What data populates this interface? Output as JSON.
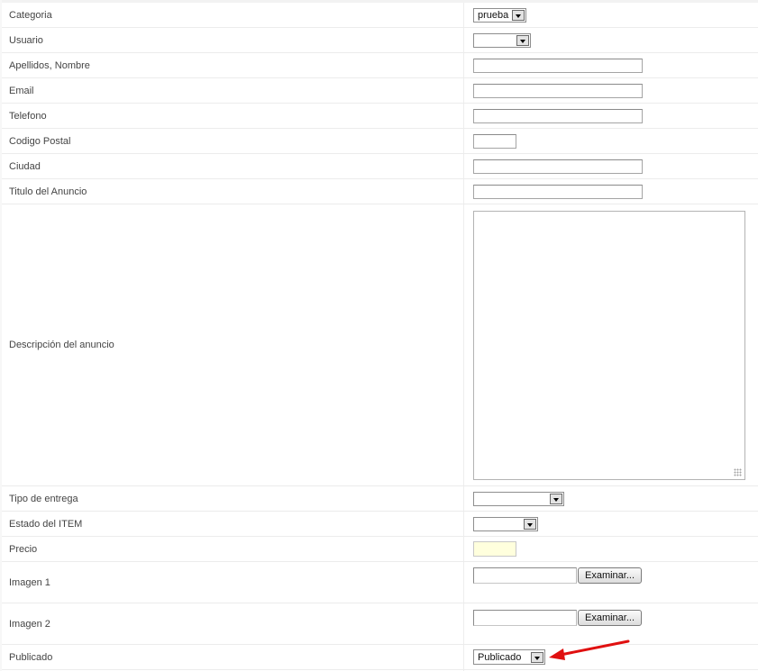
{
  "form": {
    "rows": [
      {
        "label": "Categoria"
      },
      {
        "label": "Usuario"
      },
      {
        "label": "Apellidos, Nombre"
      },
      {
        "label": "Email"
      },
      {
        "label": "Telefono"
      },
      {
        "label": "Codigo Postal"
      },
      {
        "label": "Ciudad"
      },
      {
        "label": "Titulo del Anuncio"
      },
      {
        "label": "Descripción del anuncio"
      },
      {
        "label": "Tipo de entrega"
      },
      {
        "label": "Estado del ITEM"
      },
      {
        "label": "Precio"
      },
      {
        "label": "Imagen 1"
      },
      {
        "label": "Imagen 2"
      },
      {
        "label": "Publicado"
      }
    ],
    "categoria_value": "prueba",
    "usuario_value": "",
    "tipo_entrega_value": "",
    "estado_item_value": "",
    "imagen_button_label": "Examinar...",
    "publicado_value": "Publicado"
  },
  "colors": {
    "annotation_arrow": "#e01010",
    "precio_highlight": "#ffffdd"
  },
  "icons": {
    "dropdown": "chevron-down-icon",
    "resize": "resize-grip-icon",
    "annotation": "red-arrow-icon"
  }
}
